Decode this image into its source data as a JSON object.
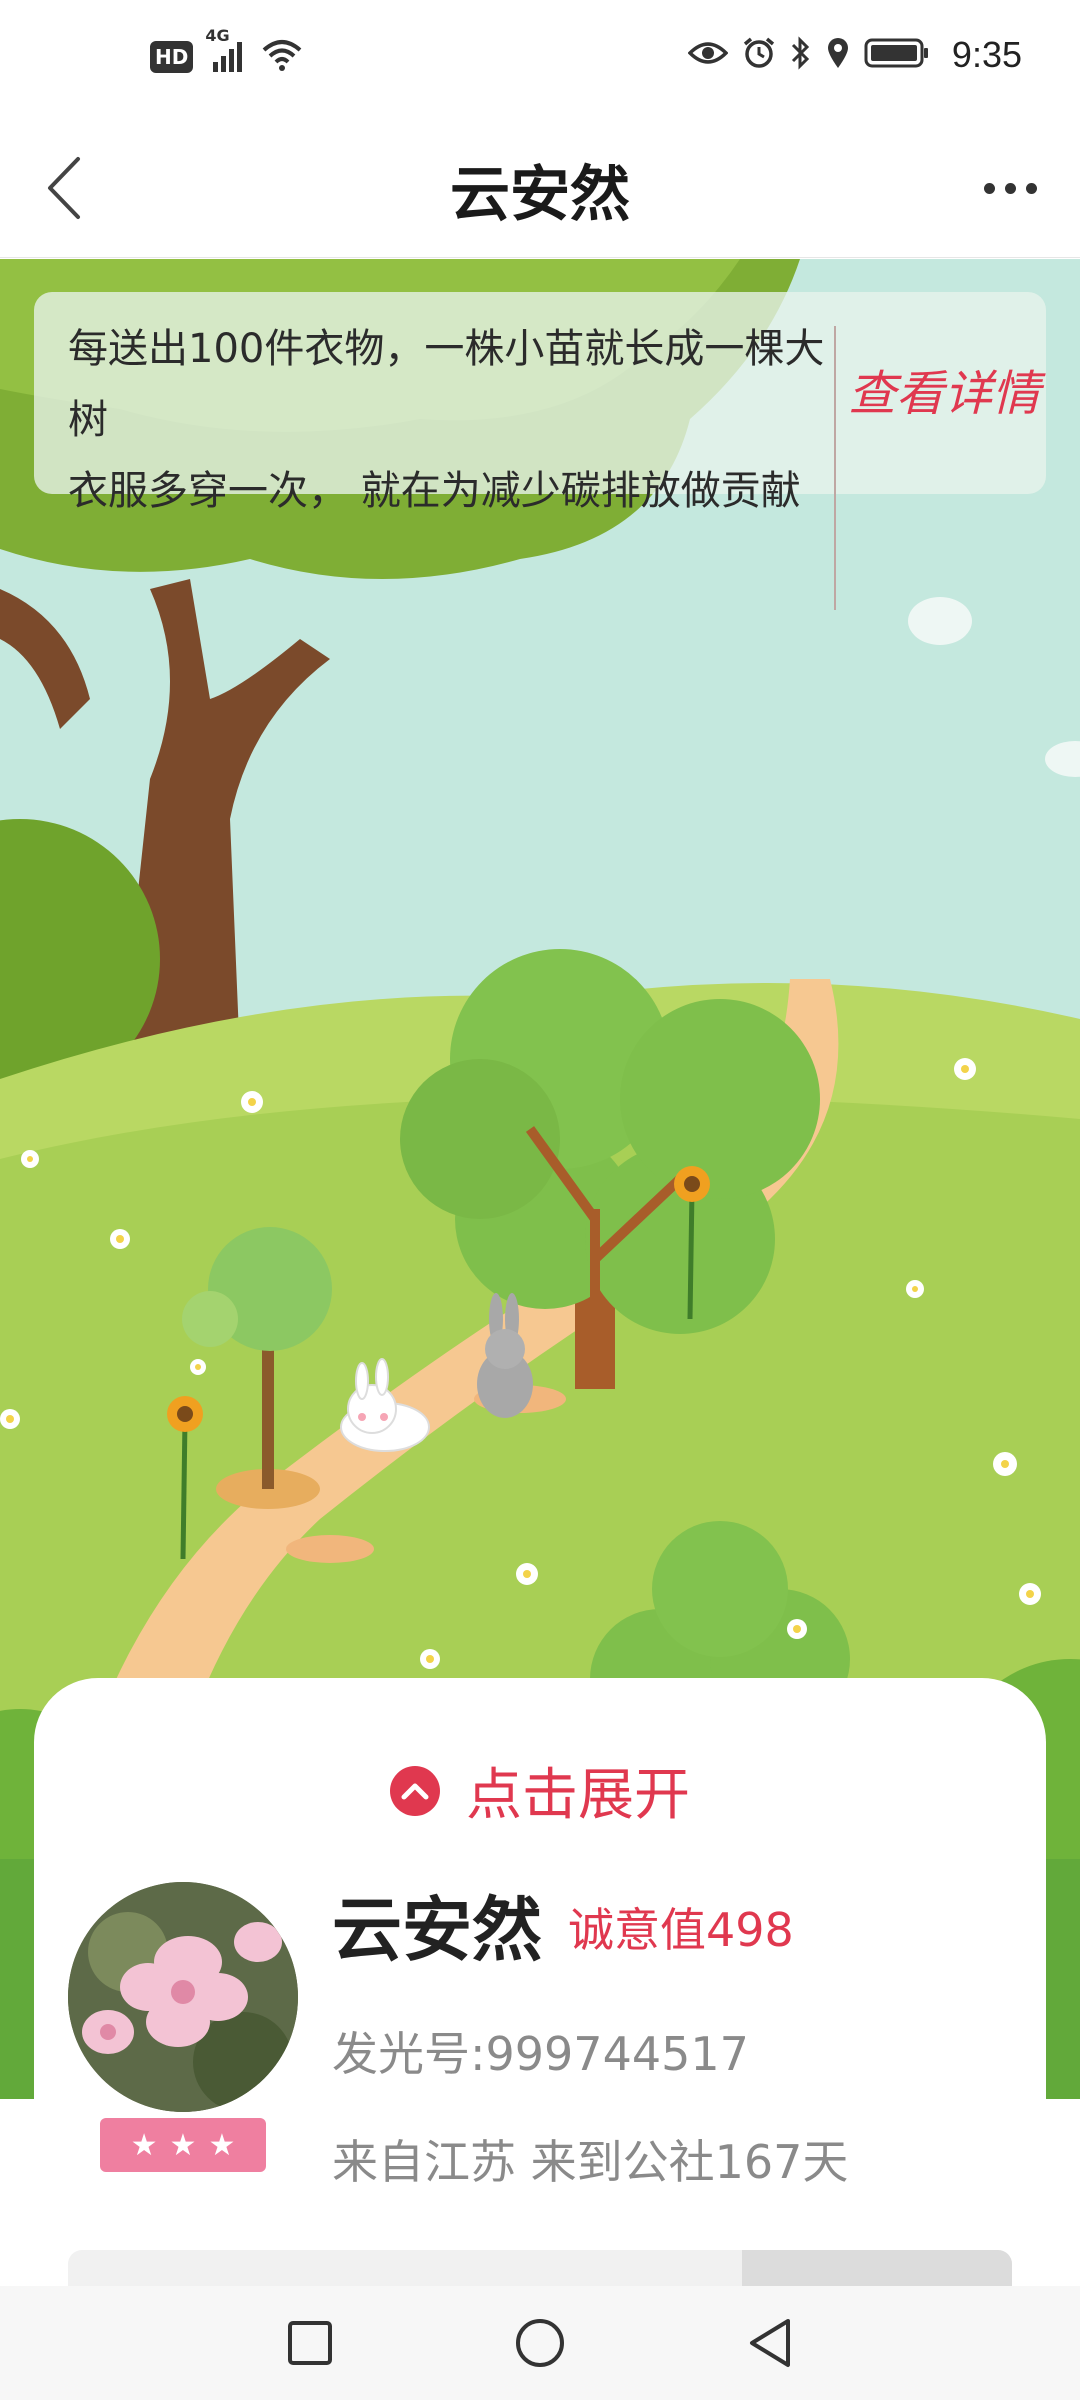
{
  "status_bar": {
    "left_icons": [
      "hd-icon",
      "4g-signal-icon",
      "wifi-icon"
    ],
    "hd_text": "HD",
    "network_text": "4G",
    "right_icons": [
      "eye-icon",
      "alarm-icon",
      "bluetooth-icon",
      "location-icon",
      "battery-icon"
    ],
    "time": "9:35"
  },
  "header": {
    "title": "云安然",
    "back_icon": "chevron-left-icon",
    "more_icon": "more-dots-icon"
  },
  "banner": {
    "text_line1": "每送出100件衣物，一株小苗就长成一棵大树",
    "text_line2": "衣服多穿一次， 就在为减少碳排放做贡献",
    "link_label": "查看详情"
  },
  "profile": {
    "expand_label": "点击展开",
    "expand_icon": "chevron-up-circle-icon",
    "name": "云安然",
    "sincerity": "诚意值498",
    "glow_id": "发光号:999744517",
    "origin": "来自江苏 来到公社167天",
    "stars": 3,
    "star_glyph": "★"
  },
  "nav_bar": {
    "icons": [
      "square-icon",
      "circle-home-icon",
      "triangle-back-icon"
    ]
  },
  "colors": {
    "accent": "#e0384f",
    "badge": "#ef7fa0",
    "sky": "#bfe6dc",
    "grass": "#a8cf55",
    "path": "#f6c891"
  }
}
